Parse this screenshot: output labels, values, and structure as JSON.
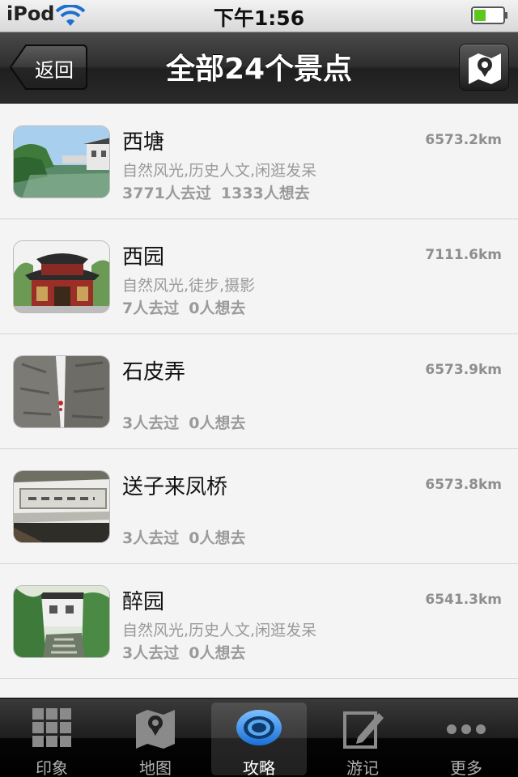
{
  "status_bar": {
    "carrier": "iPod",
    "time": "下午1:56"
  },
  "nav": {
    "back_label": "返回",
    "title": "全部24个景点",
    "map_button_icon": "map-pin-icon"
  },
  "spots": [
    {
      "name": "西塘",
      "distance": "6573.2km",
      "tags": "自然风光,历史人文,闲逛发呆",
      "visited": "3771人去过",
      "wanted": "1333人想去"
    },
    {
      "name": "西园",
      "distance": "7111.6km",
      "tags": "自然风光,徒步,摄影",
      "visited": "7人去过",
      "wanted": "0人想去"
    },
    {
      "name": "石皮弄",
      "distance": "6573.9km",
      "tags": "",
      "visited": "3人去过",
      "wanted": "0人想去"
    },
    {
      "name": "送子来凤桥",
      "distance": "6573.8km",
      "tags": "",
      "visited": "3人去过",
      "wanted": "0人想去"
    },
    {
      "name": "醉园",
      "distance": "6541.3km",
      "tags": "自然风光,历史人文,闲逛发呆",
      "visited": "3人去过",
      "wanted": "0人想去"
    }
  ],
  "tabs": [
    {
      "label": "印象",
      "icon": "grid-icon"
    },
    {
      "label": "地图",
      "icon": "map-icon"
    },
    {
      "label": "攻略",
      "icon": "eye-icon",
      "active": true
    },
    {
      "label": "游记",
      "icon": "edit-icon"
    },
    {
      "label": "更多",
      "icon": "more-icon"
    }
  ],
  "colors": {
    "accent": "#3a8ee6",
    "battery": "#5ac81f"
  }
}
